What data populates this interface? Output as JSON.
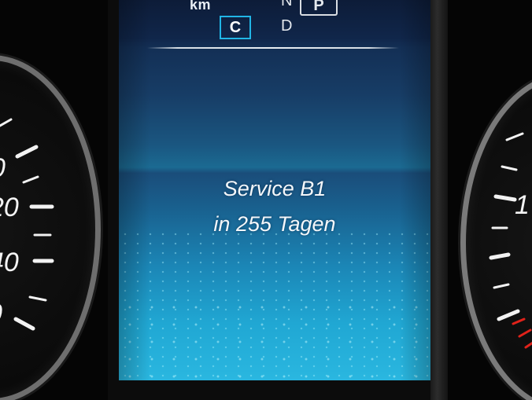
{
  "left_gauge": {
    "tick_labels": [
      "0",
      "20",
      "40",
      "0"
    ]
  },
  "right_gauge": {
    "tick_labels": [
      "1"
    ],
    "accent_color": "#e0221a"
  },
  "display": {
    "odometer_unit": "km",
    "gear": {
      "current": "C",
      "neutral": "N",
      "drive": "D",
      "park": "P"
    },
    "message": {
      "title": "Service B1",
      "detail": "in 255 Tagen"
    },
    "bottom_icon": "car-assist-icon",
    "accent_color": "#21b6e6"
  }
}
